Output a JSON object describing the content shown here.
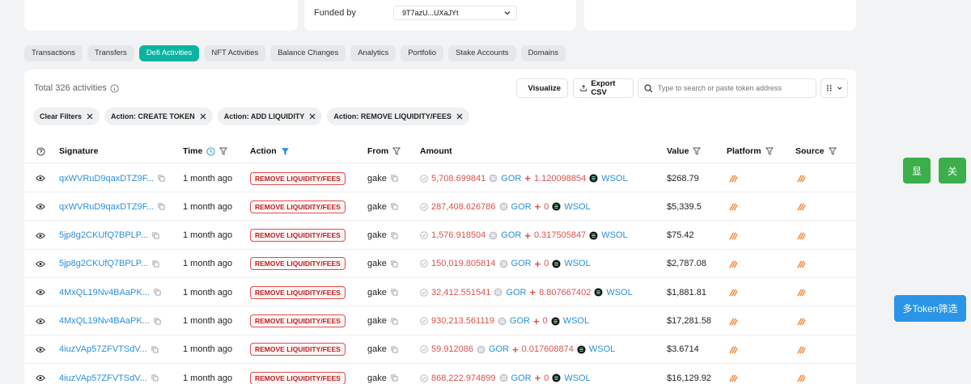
{
  "funded": {
    "label": "Funded by",
    "value": "9T7azU...UXaJYt"
  },
  "tabs": [
    "Transactions",
    "Transfers",
    "Defi Activities",
    "NFT Activities",
    "Balance Changes",
    "Analytics",
    "Portfolio",
    "Stake Accounts",
    "Domains"
  ],
  "active_tab": "Defi Activities",
  "toolbar": {
    "total": "Total 326 activities",
    "visualize": "Visualize",
    "export": "Export CSV",
    "search_placeholder": "Type to search or paste token address"
  },
  "filters": {
    "clear": "Clear Filters",
    "chips": [
      "Action: CREATE TOKEN",
      "Action: ADD LIQUIDITY",
      "Action: REMOVE LIQUIDITY/FEES"
    ]
  },
  "columns": {
    "signature": "Signature",
    "time": "Time",
    "action": "Action",
    "from": "From",
    "amount": "Amount",
    "value": "Value",
    "platform": "Platform",
    "source": "Source"
  },
  "rows": [
    {
      "signature": "qxWVRuD9qaxDTZ9F...",
      "time": "1 month ago",
      "action": "REMOVE LIQUIDITY/FEES",
      "from": "gake",
      "amount1": "5,708.699841",
      "token1": "GOR",
      "amount2": "1.120098854",
      "token2": "WSOL",
      "value": "$268.79"
    },
    {
      "signature": "qxWVRuD9qaxDTZ9F...",
      "time": "1 month ago",
      "action": "REMOVE LIQUIDITY/FEES",
      "from": "gake",
      "amount1": "287,408.626786",
      "token1": "GOR",
      "amount2": "0",
      "token2": "WSOL",
      "value": "$5,339.5"
    },
    {
      "signature": "5jp8g2CKUfQ7BPLP...",
      "time": "1 month ago",
      "action": "REMOVE LIQUIDITY/FEES",
      "from": "gake",
      "amount1": "1,576.918504",
      "token1": "GOR",
      "amount2": "0.317505847",
      "token2": "WSOL",
      "value": "$75.42"
    },
    {
      "signature": "5jp8g2CKUfQ7BPLP...",
      "time": "1 month ago",
      "action": "REMOVE LIQUIDITY/FEES",
      "from": "gake",
      "amount1": "150,019.805814",
      "token1": "GOR",
      "amount2": "0",
      "token2": "WSOL",
      "value": "$2,787.08"
    },
    {
      "signature": "4MxQL19Nv4BAaPK...",
      "time": "1 month ago",
      "action": "REMOVE LIQUIDITY/FEES",
      "from": "gake",
      "amount1": "32,412.551541",
      "token1": "GOR",
      "amount2": "8.807667402",
      "token2": "WSOL",
      "value": "$1,881.81"
    },
    {
      "signature": "4MxQL19Nv4BAaPK...",
      "time": "1 month ago",
      "action": "REMOVE LIQUIDITY/FEES",
      "from": "gake",
      "amount1": "930,213.561119",
      "token1": "GOR",
      "amount2": "0",
      "token2": "WSOL",
      "value": "$17,281.58"
    },
    {
      "signature": "4iuzVAp57ZFVTSdV...",
      "time": "1 month ago",
      "action": "REMOVE LIQUIDITY/FEES",
      "from": "gake",
      "amount1": "59.912086",
      "token1": "GOR",
      "amount2": "0.017608874",
      "token2": "WSOL",
      "value": "$3.6714"
    },
    {
      "signature": "4iuzVAp57ZFVTSdV...",
      "time": "1 month ago",
      "action": "REMOVE LIQUIDITY/FEES",
      "from": "gake",
      "amount1": "868,222.974899",
      "token1": "GOR",
      "amount2": "0",
      "token2": "WSOL",
      "value": "$16,129.92"
    }
  ],
  "side_buttons": {
    "show": "显",
    "close": "关",
    "multi_token": "多Token筛选"
  },
  "colors": {
    "accent": "#0ab4a0",
    "link": "#2b8fd9",
    "danger": "#d9534f",
    "green_btn": "#3cae4a",
    "blue_btn": "#2a95e6"
  },
  "icons": [
    "info-icon",
    "chart-icon",
    "export-icon",
    "search-icon",
    "columns-icon",
    "close-icon",
    "clock-icon",
    "filter-icon",
    "eye-icon",
    "copy-icon",
    "gor-token-icon",
    "wsol-token-icon",
    "platform-logo-icon",
    "source-logo-icon"
  ]
}
